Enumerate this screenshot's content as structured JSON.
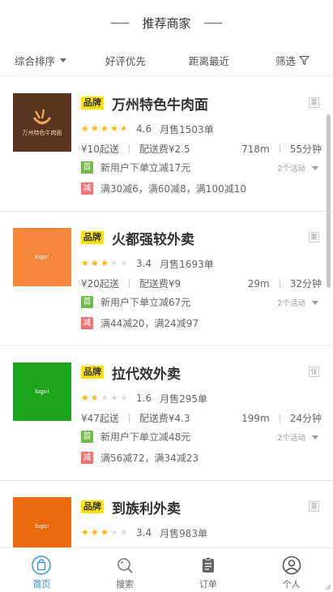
{
  "header": {
    "title": "推荐商家"
  },
  "filters": {
    "sort_label": "综合排序",
    "good_rating_label": "好评优先",
    "nearest_label": "距离最近",
    "filter_label": "筛选"
  },
  "shops": [
    {
      "brand": "品牌",
      "name": "万州特色牛肉面",
      "tag": "票",
      "logo_text": "万州特色牛肉面",
      "logo_color": "#5a3320",
      "rating": 4.6,
      "score": "4.6",
      "monthly": "月售1503单",
      "min_order": "¥10起送",
      "delivery_fee": "配送费¥2.5",
      "distance": "718m",
      "time": "55分钟",
      "act_new": "新用户下单立减17元",
      "act_minus": "满30减6，满60减8，满100减10",
      "act_count": "2个活动",
      "badge_first": "首",
      "badge_minus": "减"
    },
    {
      "brand": "品牌",
      "name": "火都强较外卖",
      "tag": "票",
      "logo_text": "logo!",
      "logo_color": "#f5873a",
      "rating": 3.4,
      "score": "3.4",
      "monthly": "月售1693单",
      "min_order": "¥20起送",
      "delivery_fee": "配送费¥9",
      "distance": "29m",
      "time": "32分钟",
      "act_new": "新用户下单立减67元",
      "act_minus": "满44减20，满24减97",
      "act_count": "2个活动",
      "badge_first": "首",
      "badge_minus": "减"
    },
    {
      "brand": "品牌",
      "name": "拉代效外卖",
      "tag": "保",
      "logo_text": "logo!",
      "logo_color": "#1aa51c",
      "rating": 1.6,
      "score": "1.6",
      "monthly": "月售295单",
      "min_order": "¥47起送",
      "delivery_fee": "配送费¥4.3",
      "distance": "199m",
      "time": "24分钟",
      "act_new": "新用户下单立减48元",
      "act_minus": "满56减72，满34减23",
      "act_count": "2个活动",
      "badge_first": "首",
      "badge_minus": "减"
    },
    {
      "brand": "品牌",
      "name": "到族利外卖",
      "tag": "票",
      "logo_text": "logo!",
      "logo_color": "#ec6a0c",
      "rating": 3.4,
      "score": "3.4",
      "monthly": "月售983单"
    }
  ],
  "tabbar": {
    "home": "首页",
    "search": "搜索",
    "orders": "订单",
    "profile": "个人",
    "active_color": "#3190e8"
  }
}
